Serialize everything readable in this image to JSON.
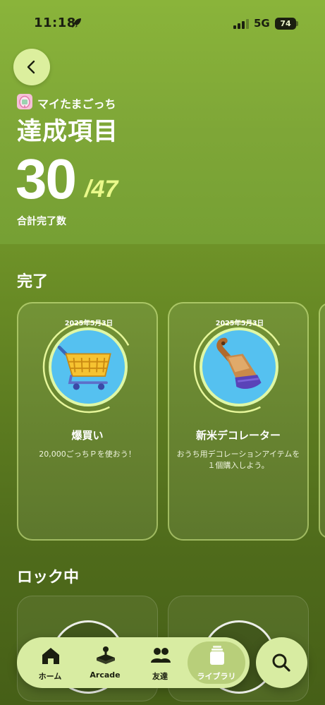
{
  "status_bar": {
    "time": "11:18",
    "network": "5G",
    "battery": "74"
  },
  "header": {
    "app_name": "マイたまごっち",
    "title": "達成項目",
    "completed_count": "30",
    "total_count": "/47",
    "count_label": "合計完了数"
  },
  "sections": {
    "completed_title": "完了",
    "locked_title": "ロック中"
  },
  "completed_cards": [
    {
      "date": "2025年5月3日",
      "title": "爆買い",
      "description": "20,000ごっちＰを使おう！",
      "icon": "shopping-basket-icon"
    },
    {
      "date": "2025年5月3日",
      "title": "新米デコレーター",
      "description": "おうち用デコレーションアイテムを１個購入しよう。",
      "icon": "paintbrush-icon"
    }
  ],
  "tab_bar": {
    "tabs": [
      {
        "label": "ホーム",
        "icon": "home-icon"
      },
      {
        "label": "Arcade",
        "icon": "arcade-icon"
      },
      {
        "label": "友達",
        "icon": "friends-icon"
      },
      {
        "label": "ライブラリ",
        "icon": "library-icon",
        "active": true
      }
    ],
    "search_icon": "search-icon"
  },
  "colors": {
    "accent": "#dcef9e",
    "highlight": "#eaf98a",
    "badge_blue": "#55c1f0"
  }
}
